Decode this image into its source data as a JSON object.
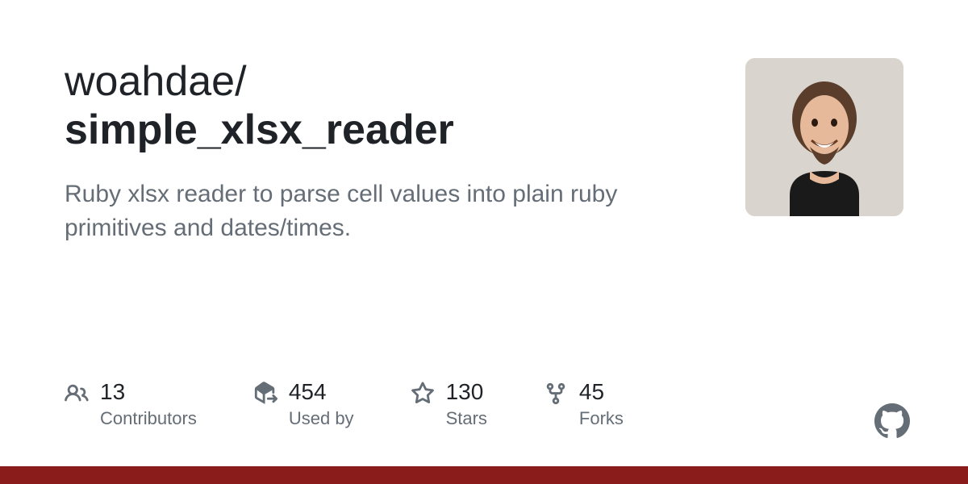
{
  "repo": {
    "owner": "woahdae",
    "separator": "/",
    "name": "simple_xlsx_reader",
    "description": "Ruby xlsx reader to parse cell values into plain ruby primitives and dates/times."
  },
  "stats": {
    "contributors": {
      "count": "13",
      "label": "Contributors"
    },
    "usedby": {
      "count": "454",
      "label": "Used by"
    },
    "stars": {
      "count": "130",
      "label": "Stars"
    },
    "forks": {
      "count": "45",
      "label": "Forks"
    }
  },
  "colors": {
    "accent_bar": "#8a1c1c"
  }
}
